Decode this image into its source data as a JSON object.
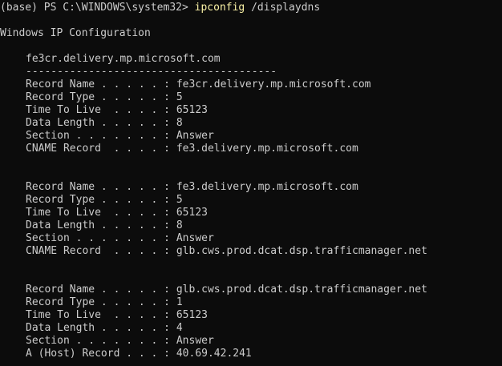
{
  "prompt": {
    "prefix": "(base) PS C:\\WINDOWS\\system32> ",
    "command": "ipconfig",
    "args": " /displaydns"
  },
  "heading": "Windows IP Configuration",
  "section_title": "fe3cr.delivery.mp.microsoft.com",
  "separator": "----------------------------------------",
  "records": [
    {
      "lines": [
        "Record Name . . . . . : fe3cr.delivery.mp.microsoft.com",
        "Record Type . . . . . : 5",
        "Time To Live  . . . . : 65123",
        "Data Length . . . . . : 8",
        "Section . . . . . . . : Answer",
        "CNAME Record  . . . . : fe3.delivery.mp.microsoft.com"
      ]
    },
    {
      "lines": [
        "Record Name . . . . . : fe3.delivery.mp.microsoft.com",
        "Record Type . . . . . : 5",
        "Time To Live  . . . . : 65123",
        "Data Length . . . . . : 8",
        "Section . . . . . . . : Answer",
        "CNAME Record  . . . . : glb.cws.prod.dcat.dsp.trafficmanager.net"
      ]
    },
    {
      "lines": [
        "Record Name . . . . . : glb.cws.prod.dcat.dsp.trafficmanager.net",
        "Record Type . . . . . : 1",
        "Time To Live  . . . . : 65123",
        "Data Length . . . . . : 4",
        "Section . . . . . . . : Answer",
        "A (Host) Record . . . : 40.69.42.241"
      ]
    }
  ],
  "colors": {
    "background": "#0c0c0c",
    "text": "#cccccc",
    "command": "#f9f1a5"
  }
}
